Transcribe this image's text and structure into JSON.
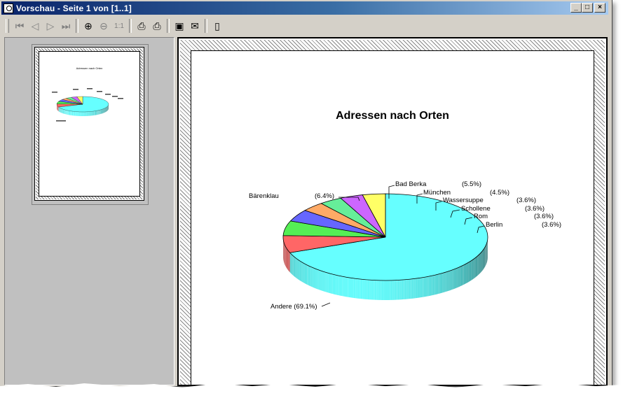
{
  "window": {
    "title": "Vorschau - Seite 1 von [1..1]",
    "buttons": {
      "minimize": "_",
      "maximize": "□",
      "close": "×"
    }
  },
  "toolbar": {
    "icons": [
      "first-page-icon",
      "prev-page-icon",
      "next-page-icon",
      "last-page-icon",
      "zoom-in-icon",
      "zoom-out-icon",
      "zoom-100-icon",
      "print-icon",
      "print-all-icon",
      "save-icon",
      "send-icon",
      "exit-icon"
    ]
  },
  "thumbnail": {
    "title": "Adressen nach Orten"
  },
  "chart_data": {
    "type": "pie",
    "title": "Adressen nach Orten",
    "labels": [
      "Andere",
      "Bärenklau",
      "Bad Berka",
      "München",
      "Wassersuppe",
      "Schollene",
      "Rom",
      "Berlin"
    ],
    "values": [
      69.1,
      6.4,
      5.5,
      4.5,
      3.6,
      3.6,
      3.6,
      3.6
    ],
    "percent_labels": [
      "(69.1%)",
      "(6.4%)",
      "(5.5%)",
      "(4.5%)",
      "(3.6%)",
      "(3.6%)",
      "(3.6%)",
      "(3.6%)"
    ],
    "colors": [
      "#66ffff",
      "#ff6666",
      "#55ee55",
      "#6666ff",
      "#ffaa66",
      "#66ee99",
      "#cc66ff",
      "#ffff66"
    ],
    "start_angle_deg": 90,
    "style": "3d-exploded-none",
    "legend": "labels-with-leader-lines"
  }
}
